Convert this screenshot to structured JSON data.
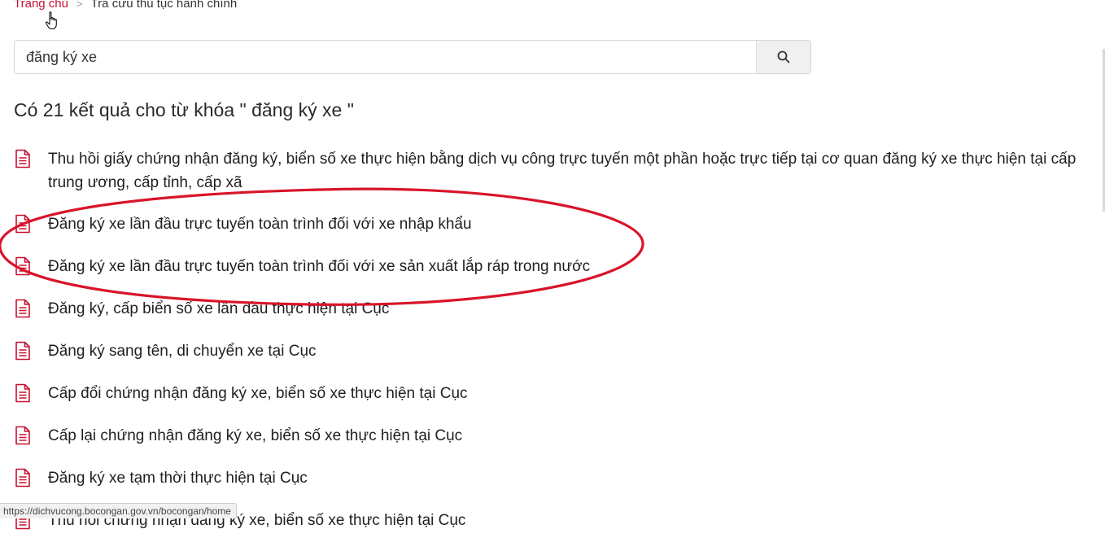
{
  "breadcrumb": {
    "home": "Trang chủ",
    "separator": ">",
    "current": "Tra cứu thủ tục hành chính"
  },
  "search": {
    "value": "đăng ký xe",
    "icon": "search-icon"
  },
  "results_title": "Có 21 kết quả cho từ khóa \" đăng ký xe \"",
  "results": [
    {
      "label": "Thu hồi giấy chứng nhận đăng ký, biển số xe thực hiện bằng dịch vụ công trực tuyến một phần hoặc trực tiếp tại cơ quan đăng ký xe thực hiện tại cấp trung ương, cấp tỉnh, cấp xã"
    },
    {
      "label": "Đăng ký xe lần đầu trực tuyến toàn trình đối với xe nhập khẩu"
    },
    {
      "label": "Đăng ký xe lần đầu trực tuyến toàn trình đối với xe sản xuất lắp ráp trong nước"
    },
    {
      "label": "Đăng ký, cấp biển số xe lần đầu thực hiện tại Cục"
    },
    {
      "label": "Đăng ký sang tên, di chuyển xe tại Cục"
    },
    {
      "label": "Cấp đổi chứng nhận đăng ký xe, biển số xe thực hiện tại Cục"
    },
    {
      "label": "Cấp lại chứng nhận đăng ký xe, biển số xe thực hiện tại Cục"
    },
    {
      "label": "Đăng ký xe tạm thời thực hiện tại Cục"
    },
    {
      "label": "Thu hồi chứng nhận đăng ký xe, biển số xe thực hiện tại Cục"
    }
  ],
  "status_bar": "https://dichvucong.bocongan.gov.vn/bocongan/home",
  "colors": {
    "accent": "#c8102e",
    "annotation": "#d9142a"
  }
}
